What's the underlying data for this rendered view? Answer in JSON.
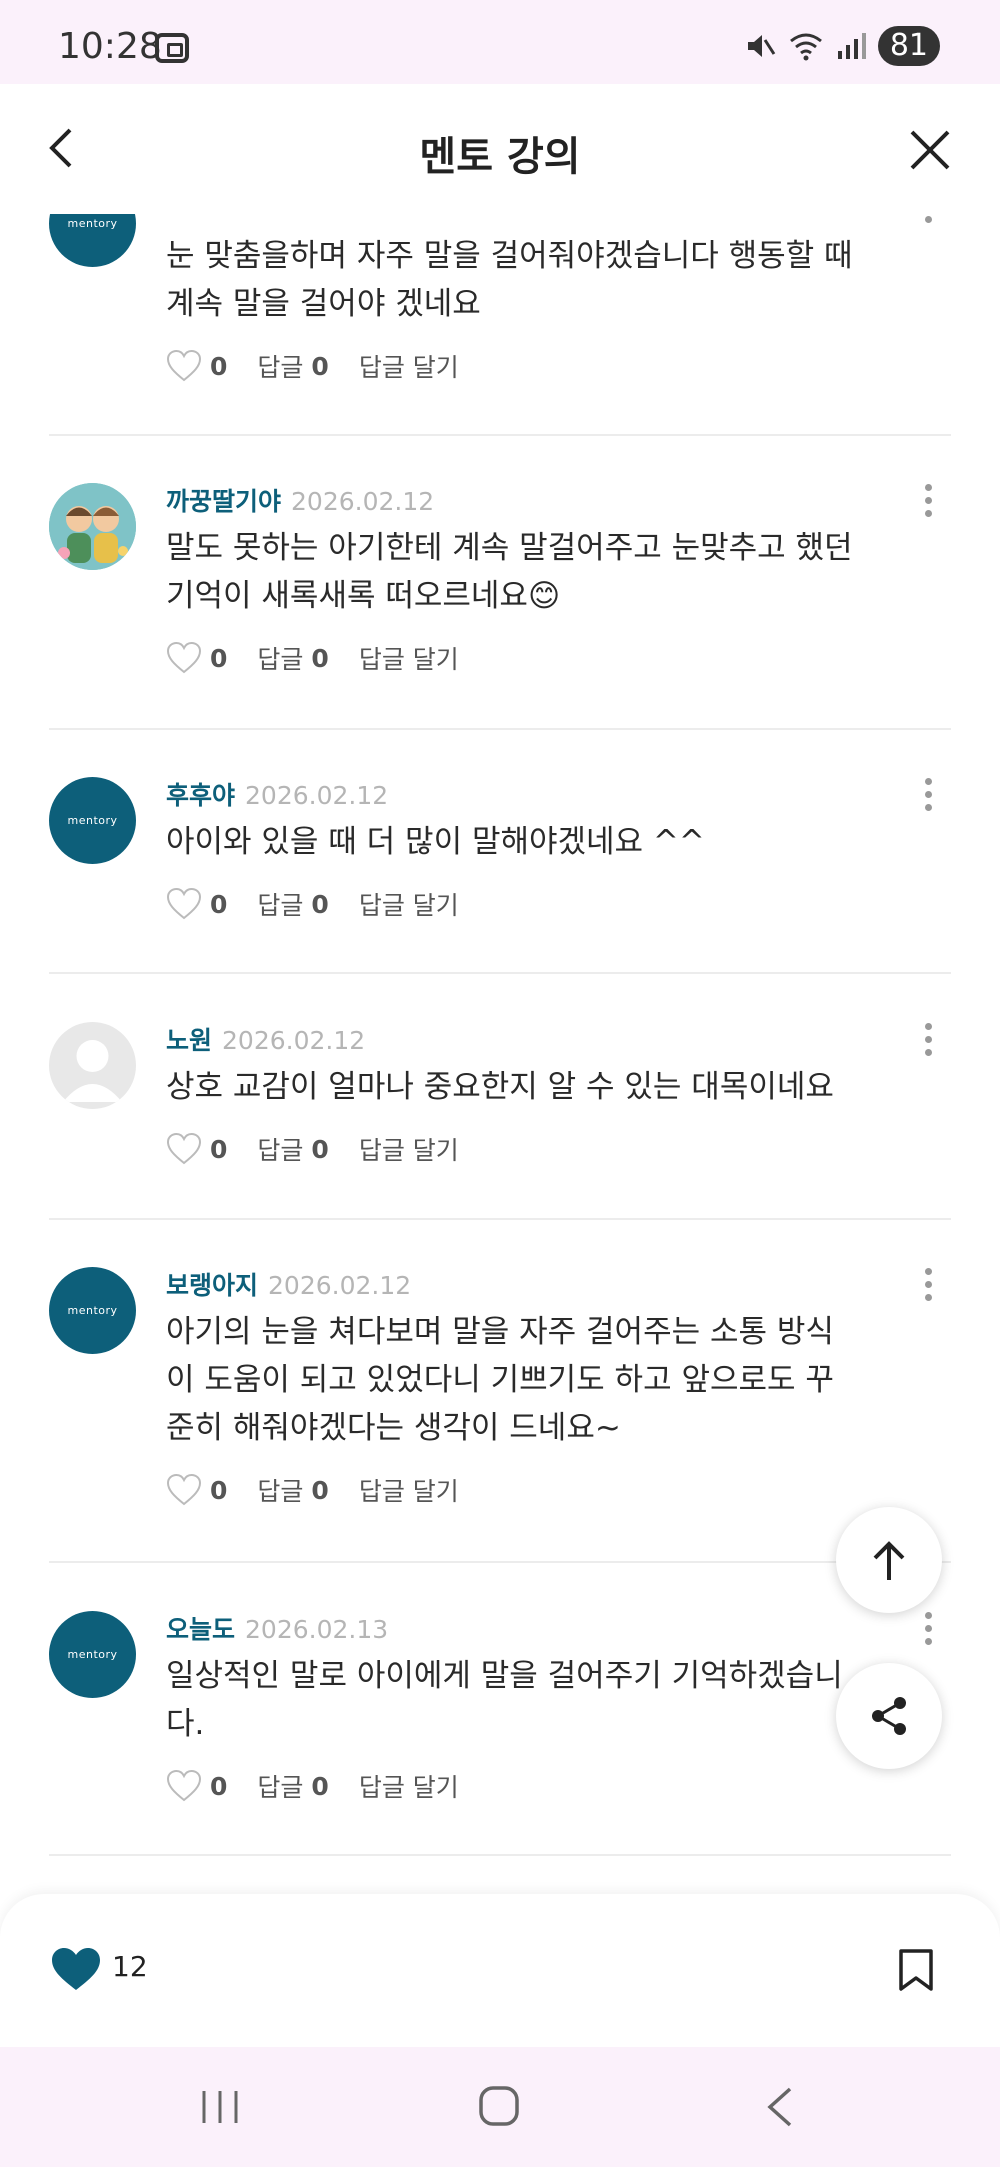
{
  "status_bar": {
    "time": "10:28",
    "battery": "81"
  },
  "header": {
    "title": "멘토 강의"
  },
  "comments": [
    {
      "name": "",
      "date": "",
      "text": "눈 맞춤을하며 자주 말을 걸어줘야겠습니다 행동할 때 계속 말을 걸어야 겠네요",
      "likes": "0",
      "reply_label": "답글",
      "replies": "0",
      "write_reply": "답글 달기",
      "avatar": "mentory-logo"
    },
    {
      "name": "까꿍딸기야",
      "date": "2026.02.12",
      "text": "말도 못하는 아기한테 계속 말걸어주고 눈맞추고 했던 기억이 새록새록 떠오르네요😊",
      "likes": "0",
      "reply_label": "답글",
      "replies": "0",
      "write_reply": "답글 달기",
      "avatar": "photo"
    },
    {
      "name": "후후야",
      "date": "2026.02.12",
      "text": "아이와 있을  때 더 많이 말해야겠네요 ^^",
      "likes": "0",
      "reply_label": "답글",
      "replies": "0",
      "write_reply": "답글 달기",
      "avatar": "mentory-logo"
    },
    {
      "name": "노원",
      "date": "2026.02.12",
      "text": "상호 교감이 얼마나 중요한지 알 수 있는 대목이네요",
      "likes": "0",
      "reply_label": "답글",
      "replies": "0",
      "write_reply": "답글 달기",
      "avatar": "default-user"
    },
    {
      "name": "보랭아지",
      "date": "2026.02.12",
      "text": "아기의 눈을 쳐다보며 말을 자주 걸어주는 소통 방식이 도움이 되고 있었다니 기쁘기도 하고 앞으로도 꾸준히 해줘야겠다는 생각이 드네요~",
      "likes": "0",
      "reply_label": "답글",
      "replies": "0",
      "write_reply": "답글 달기",
      "avatar": "mentory-logo"
    },
    {
      "name": "오늘도",
      "date": "2026.02.13",
      "text": "일상적인 말로 아이에게 말을 걸어주기 기억하겠습니다.",
      "likes": "0",
      "reply_label": "답글",
      "replies": "0",
      "write_reply": "답글 달기",
      "avatar": "mentory-logo"
    }
  ],
  "avatar_logo_text": "mentory",
  "bottom_bar": {
    "like_count": "12"
  },
  "icons": {
    "accent_color": "#0d5f7a"
  }
}
